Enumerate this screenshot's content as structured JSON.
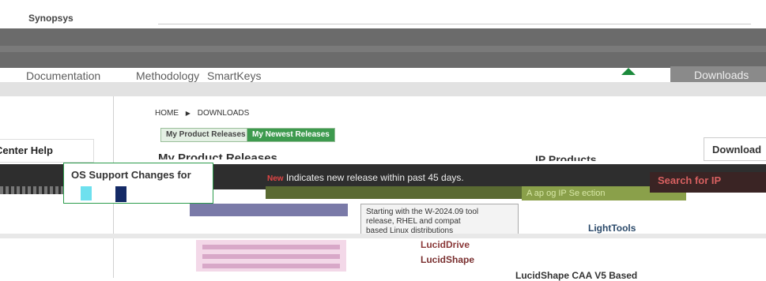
{
  "header": {
    "logo_text": "Synopsys"
  },
  "nav": {
    "items": [
      "Documentation",
      "Methodology",
      "SmartKeys"
    ],
    "downloads_tab": "Downloads"
  },
  "breadcrumb": {
    "home": "HOME",
    "current": "DOWNLOADS"
  },
  "tabs": [
    {
      "label": "My Product Releases"
    },
    {
      "label": "My Newest Releases"
    }
  ],
  "sidebar": {
    "help": "Center Help"
  },
  "right_panel": {
    "title": "Download C",
    "search": "Search for IP"
  },
  "main": {
    "product_heading": "My Product Releases",
    "ip_heading": "IP Products",
    "os_title": "OS Support Changes for",
    "new_badge": "New",
    "new_note": "Indicates new release within past 45 days.",
    "green_band": "A ap og IP Se ection",
    "notice_line1": "Starting with the W-2024.09 tool",
    "notice_line2": "release, RHEL and compat",
    "notice_line3": "based Linux distributions"
  },
  "products": {
    "light_tools": "LightTools",
    "lucid_drive": "LucidDrive",
    "lucid_shape": "LucidShape",
    "lucid_shape_caa": "LucidShape CAA V5 Based"
  },
  "colors": {
    "accent_green": "#3d9a4e",
    "dark": "#2e2e2e",
    "search_red": "#d76060"
  }
}
